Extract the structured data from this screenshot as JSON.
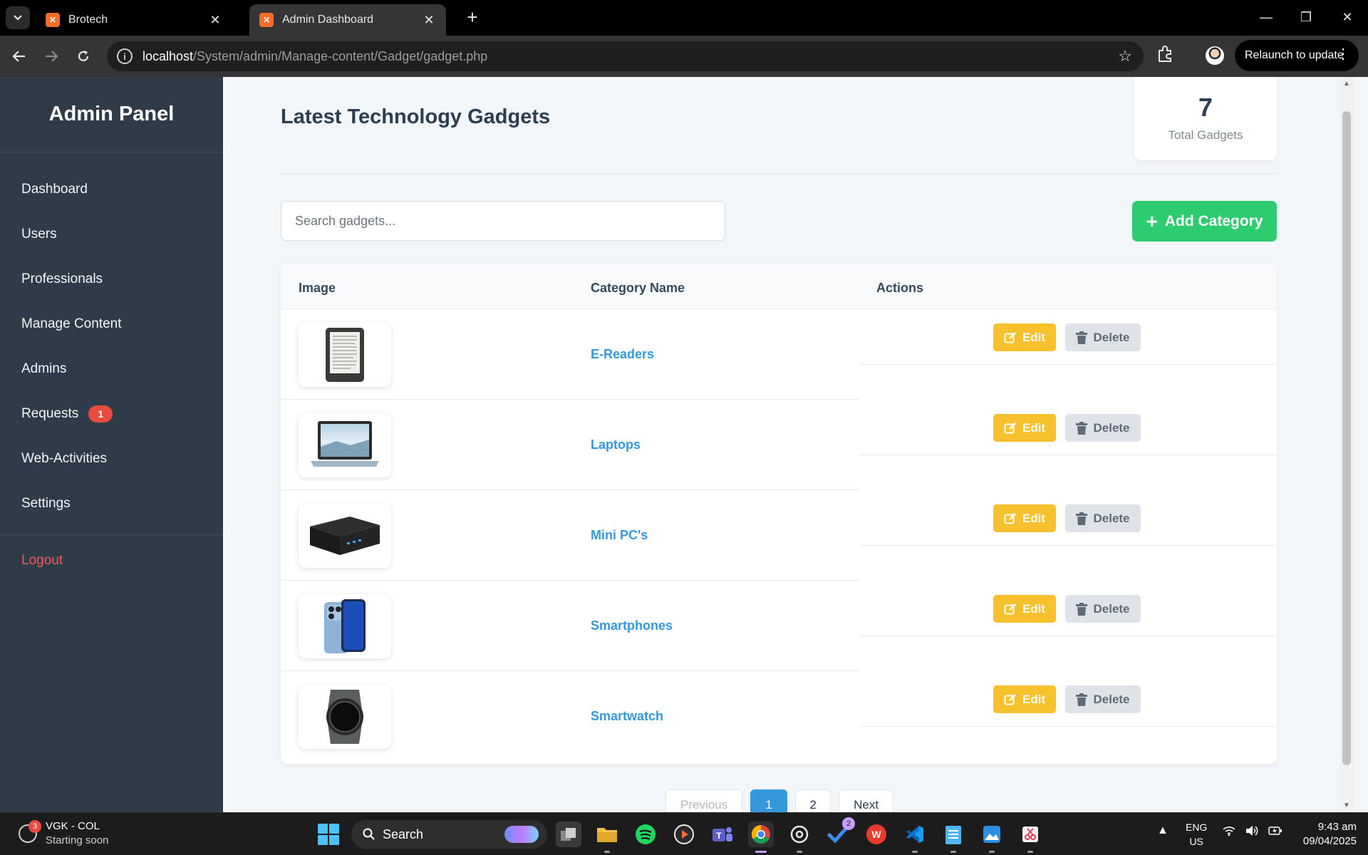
{
  "browser": {
    "tabs": [
      {
        "title": "Brotech"
      },
      {
        "title": "Admin Dashboard"
      }
    ],
    "url": {
      "host": "localhost",
      "path": "/System/admin/Manage-content/Gadget/gadget.php"
    },
    "relaunch_label": "Relaunch to update"
  },
  "sidebar": {
    "title": "Admin Panel",
    "items": [
      {
        "label": "Dashboard"
      },
      {
        "label": "Users"
      },
      {
        "label": "Professionals"
      },
      {
        "label": "Manage Content"
      },
      {
        "label": "Admins"
      },
      {
        "label": "Requests",
        "badge": "1"
      },
      {
        "label": "Web-Activities"
      },
      {
        "label": "Settings"
      }
    ],
    "logout_label": "Logout"
  },
  "main": {
    "title": "Latest Technology Gadgets",
    "stat": {
      "value": "7",
      "label": "Total Gadgets"
    },
    "search_placeholder": "Search gadgets...",
    "add_button_label": "Add Category",
    "table": {
      "headers": [
        "Image",
        "Category Name",
        "Actions"
      ],
      "rows": [
        {
          "name": "E-Readers",
          "image": "e-reader-image"
        },
        {
          "name": "Laptops",
          "image": "laptop-image"
        },
        {
          "name": "Mini PC's",
          "image": "mini-pc-image"
        },
        {
          "name": "Smartphones",
          "image": "smartphone-image"
        },
        {
          "name": "Smartwatch",
          "image": "smartwatch-image"
        }
      ],
      "edit_label": "Edit",
      "delete_label": "Delete"
    },
    "pagination": {
      "previous": "Previous",
      "pages": [
        "1",
        "2"
      ],
      "current": "1",
      "next": "Next"
    }
  },
  "taskbar": {
    "weather": {
      "badge": "3",
      "title": "VGK - COL",
      "subtitle": "Starting soon"
    },
    "search_label": "Search",
    "todo_badge": "2",
    "language": {
      "line1": "ENG",
      "line2": "US"
    },
    "time": "9:43 am",
    "date": "09/04/2025"
  },
  "colors": {
    "sidebar_bg": "#2f3b48",
    "accent_green": "#2ecc71",
    "accent_blue": "#3498db",
    "edit_yellow": "#f6c12c",
    "badge_red": "#e74c3c",
    "logout_red": "#ef5a5a"
  }
}
